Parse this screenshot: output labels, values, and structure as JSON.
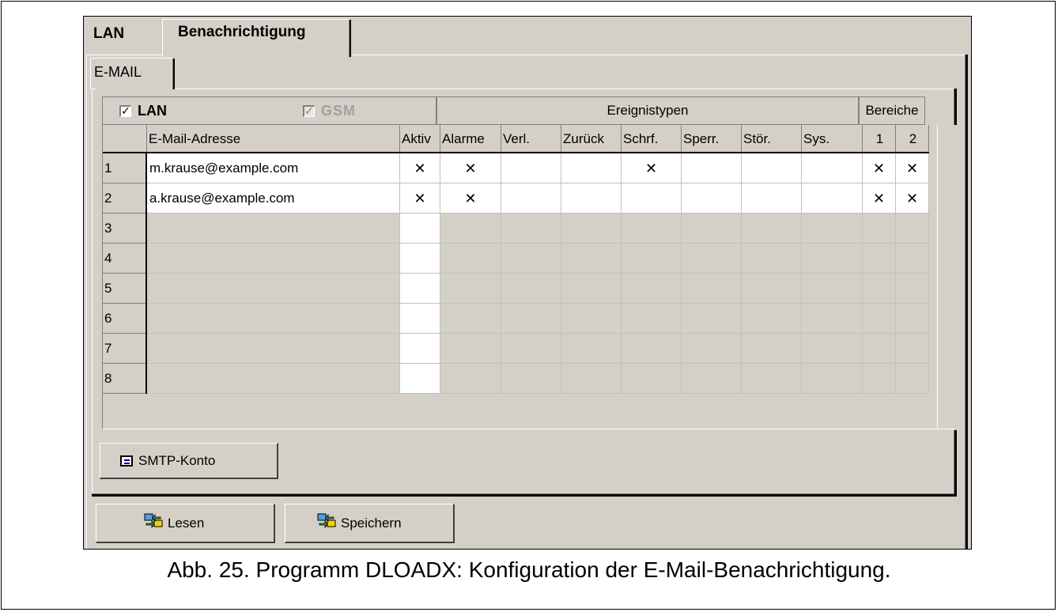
{
  "tabs": [
    {
      "label": "LAN"
    },
    {
      "label": "Benachrichtigung"
    }
  ],
  "subtab": {
    "label": "E-MAIL"
  },
  "channels": {
    "lan": {
      "label": "LAN",
      "checked": true
    },
    "gsm": {
      "label": "GSM",
      "checked": true,
      "disabled": true
    }
  },
  "group_headers": {
    "event_types": "Ereignistypen",
    "partitions": "Bereiche"
  },
  "columns": [
    "",
    "E-Mail-Adresse",
    "Aktiv",
    "Alarme",
    "Verl.",
    "Zurück",
    "Schrf.",
    "Sperr.",
    "Stör.",
    "Sys.",
    "1",
    "2"
  ],
  "rows": [
    {
      "num": "1",
      "email": "m.krause@example.com",
      "aktiv": "X",
      "alarme": "X",
      "verl": "",
      "zuruck": "",
      "schrf": "X",
      "sperr": "",
      "stor": "",
      "sys": "",
      "b1": "X",
      "b2": "X"
    },
    {
      "num": "2",
      "email": "a.krause@example.com",
      "aktiv": "X",
      "alarme": "X",
      "verl": "",
      "zuruck": "",
      "schrf": "",
      "sperr": "",
      "stor": "",
      "sys": "",
      "b1": "X",
      "b2": "X"
    },
    {
      "num": "3",
      "email": "",
      "aktiv": "",
      "alarme": "",
      "verl": "",
      "zuruck": "",
      "schrf": "",
      "sperr": "",
      "stor": "",
      "sys": "",
      "b1": "",
      "b2": ""
    },
    {
      "num": "4",
      "email": "",
      "aktiv": "",
      "alarme": "",
      "verl": "",
      "zuruck": "",
      "schrf": "",
      "sperr": "",
      "stor": "",
      "sys": "",
      "b1": "",
      "b2": ""
    },
    {
      "num": "5",
      "email": "",
      "aktiv": "",
      "alarme": "",
      "verl": "",
      "zuruck": "",
      "schrf": "",
      "sperr": "",
      "stor": "",
      "sys": "",
      "b1": "",
      "b2": ""
    },
    {
      "num": "6",
      "email": "",
      "aktiv": "",
      "alarme": "",
      "verl": "",
      "zuruck": "",
      "schrf": "",
      "sperr": "",
      "stor": "",
      "sys": "",
      "b1": "",
      "b2": ""
    },
    {
      "num": "7",
      "email": "",
      "aktiv": "",
      "alarme": "",
      "verl": "",
      "zuruck": "",
      "schrf": "",
      "sperr": "",
      "stor": "",
      "sys": "",
      "b1": "",
      "b2": ""
    },
    {
      "num": "8",
      "email": "",
      "aktiv": "",
      "alarme": "",
      "verl": "",
      "zuruck": "",
      "schrf": "",
      "sperr": "",
      "stor": "",
      "sys": "",
      "b1": "",
      "b2": ""
    }
  ],
  "buttons": {
    "smtp": {
      "label": "SMTP-Konto",
      "icon": "mail-account-icon"
    },
    "read": {
      "label": "Lesen",
      "icon": "read-from-device-icon"
    },
    "save": {
      "label": "Speichern",
      "icon": "write-to-device-icon"
    }
  },
  "caption": "Abb. 25. Programm DLOADX: Konfiguration der E-Mail-Benachrichtigung.",
  "colors": {
    "face": "#d4d0c8",
    "shadow": "#808080",
    "highlight": "#ffffff"
  }
}
